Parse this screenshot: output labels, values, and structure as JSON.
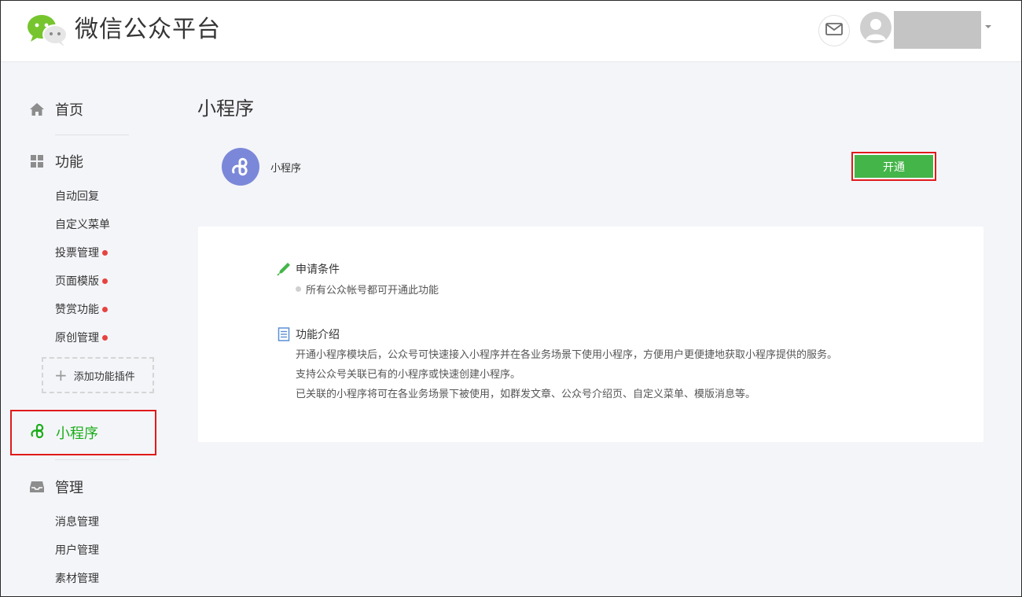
{
  "header": {
    "brand": "微信公众平台"
  },
  "sidebar": {
    "home": "首页",
    "features": {
      "label": "功能",
      "items": [
        {
          "label": "自动回复",
          "badge": false
        },
        {
          "label": "自定义菜单",
          "badge": false
        },
        {
          "label": "投票管理",
          "badge": true
        },
        {
          "label": "页面模版",
          "badge": true
        },
        {
          "label": "赞赏功能",
          "badge": true
        },
        {
          "label": "原创管理",
          "badge": true
        }
      ],
      "add_plugin": "添加功能插件"
    },
    "mini_program": "小程序",
    "manage": {
      "label": "管理",
      "items": [
        {
          "label": "消息管理"
        },
        {
          "label": "用户管理"
        },
        {
          "label": "素材管理"
        }
      ]
    }
  },
  "main": {
    "title": "小程序",
    "app_name": "小程序",
    "open_button": "开通",
    "requirements": {
      "title": "申请条件",
      "item": "所有公众帐号都可开通此功能"
    },
    "intro": {
      "title": "功能介绍",
      "lines": [
        "开通小程序模块后，公众号可快速接入小程序并在各业务场景下使用小程序，方便用户更便捷地获取小程序提供的服务。",
        "支持公众号关联已有的小程序或快速创建小程序。",
        "已关联的小程序将可在各业务场景下被使用，如群发文章、公众号介绍页、自定义菜单、模版消息等。"
      ]
    }
  },
  "colors": {
    "accent_green": "#44b549",
    "active_green": "#1aad19",
    "badge_red": "#e64340",
    "mini_program_blue": "#7b88d9"
  },
  "icons": {
    "logo": "wechat-logo",
    "mail": "mail-icon",
    "avatar": "user-avatar-icon",
    "home": "home-icon",
    "features": "grid-icon",
    "mini_program": "mini-program-icon",
    "manage": "inbox-icon",
    "requirements": "pen-icon",
    "intro": "document-icon"
  }
}
